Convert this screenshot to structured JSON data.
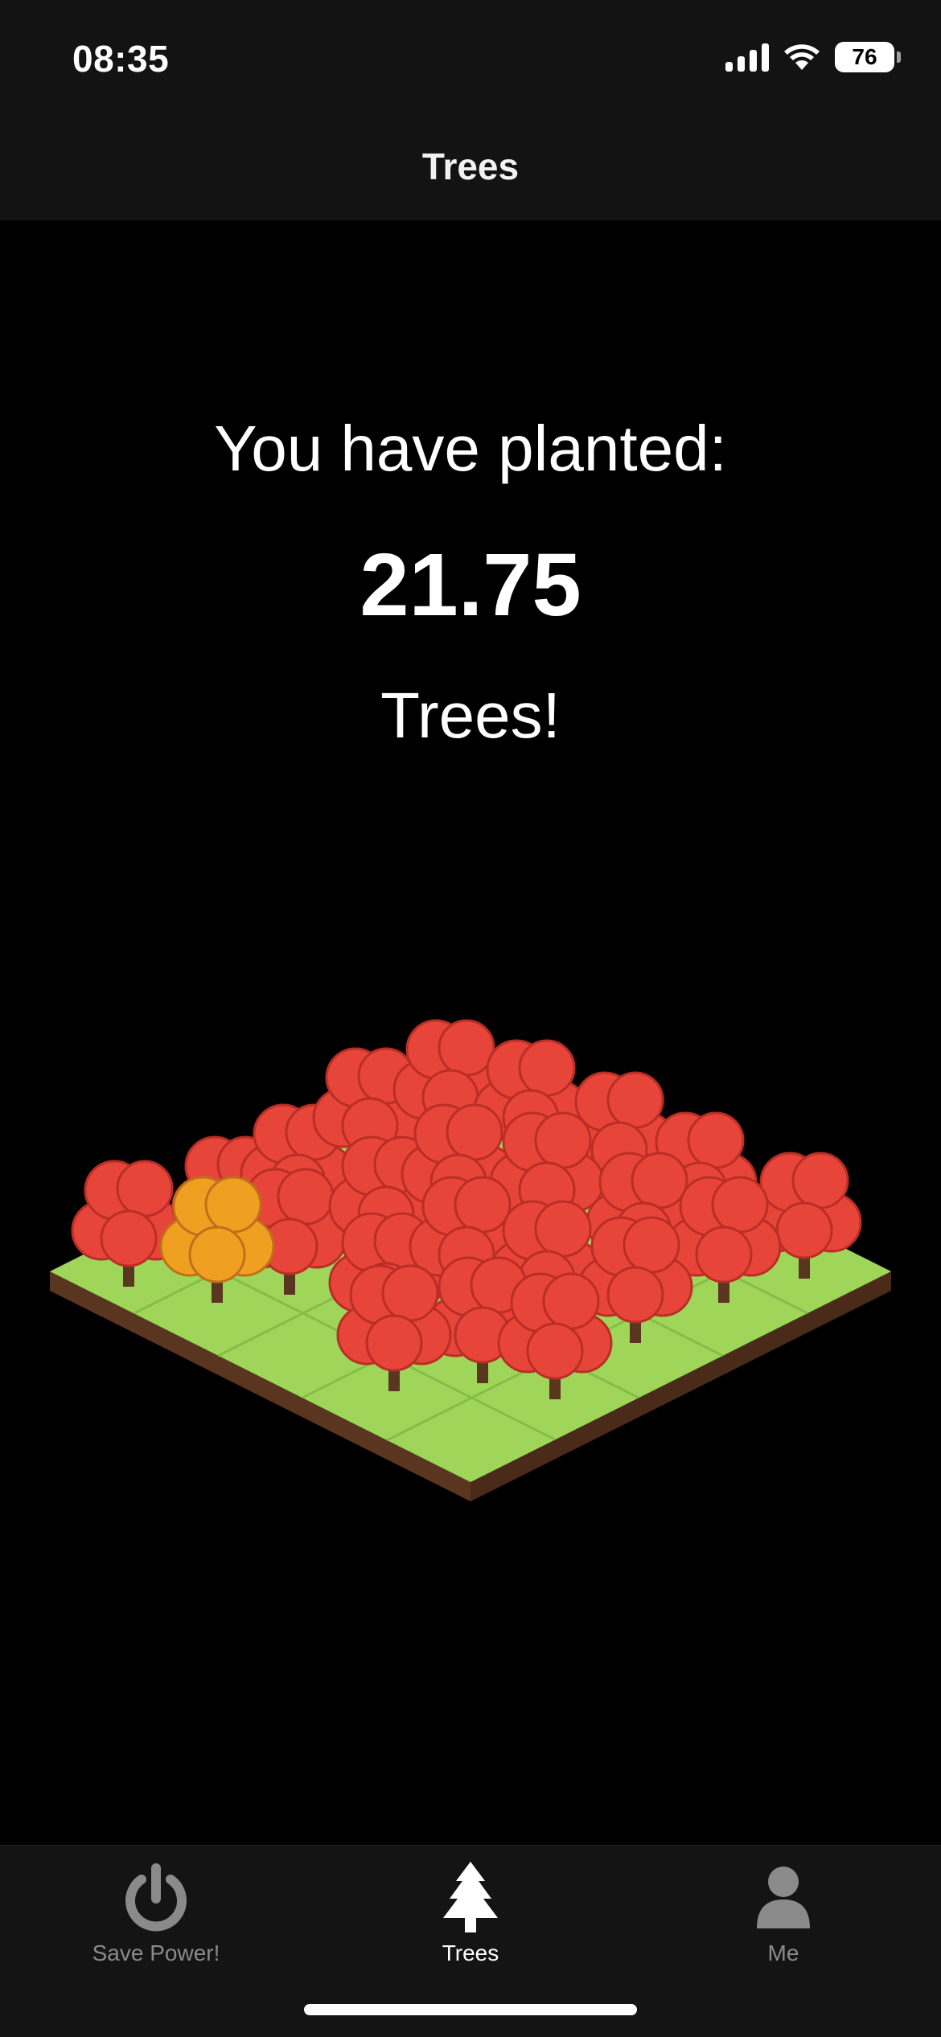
{
  "status_bar": {
    "time": "08:35",
    "battery": "76"
  },
  "nav": {
    "title": "Trees"
  },
  "main": {
    "planted_label": "You have planted:",
    "planted_count": "21.75",
    "planted_unit": "Trees!"
  },
  "tabs": [
    {
      "label": "Save Power!",
      "icon": "power-icon",
      "active": false
    },
    {
      "label": "Trees",
      "icon": "tree-icon",
      "active": true
    },
    {
      "label": "Me",
      "icon": "person-icon",
      "active": false
    }
  ],
  "colors": {
    "foliage": "#e8453a",
    "foliage_dark": "#b92e25",
    "autumn": "#f0a020",
    "grass": "#9fd65a",
    "soil": "#5a3520",
    "inactive_tab": "#8a8a8a"
  }
}
